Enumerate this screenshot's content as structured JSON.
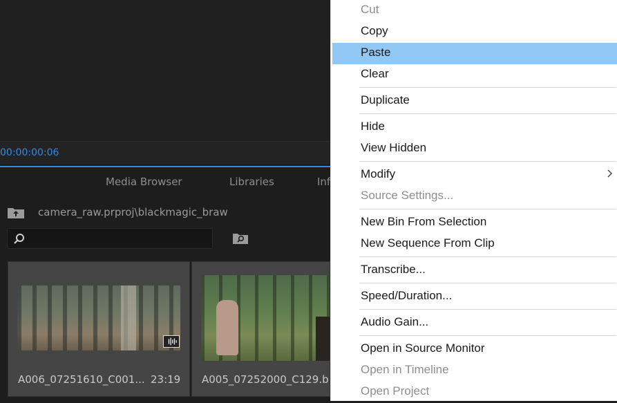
{
  "monitor": {
    "timecode": "00:00:00:06"
  },
  "panel": {
    "tabs": [
      "Media Browser",
      "Libraries",
      "Inf"
    ],
    "breadcrumb": "camera_raw.prproj\\blackmagic_braw",
    "search": {
      "value": "",
      "placeholder": ""
    }
  },
  "clips": [
    {
      "name": "A006_07251610_C001...",
      "duration": "23:19"
    },
    {
      "name": "A005_07252000_C129.b...",
      "duration": ""
    }
  ],
  "menu": {
    "items": [
      {
        "label": "Cut",
        "enabled": false
      },
      {
        "label": "Copy",
        "enabled": true
      },
      {
        "label": "Paste",
        "enabled": true,
        "highlighted": true
      },
      {
        "label": "Clear",
        "enabled": true
      },
      {
        "label": "Duplicate",
        "enabled": true
      },
      {
        "label": "Hide",
        "enabled": true
      },
      {
        "label": "View Hidden",
        "enabled": true
      },
      {
        "label": "Modify",
        "enabled": true,
        "submenu": true
      },
      {
        "label": "Source Settings...",
        "enabled": false
      },
      {
        "label": "New Bin From Selection",
        "enabled": true
      },
      {
        "label": "New Sequence From Clip",
        "enabled": true
      },
      {
        "label": "Transcribe...",
        "enabled": true
      },
      {
        "label": "Speed/Duration...",
        "enabled": true
      },
      {
        "label": "Audio Gain...",
        "enabled": true
      },
      {
        "label": "Open in Source Monitor",
        "enabled": true
      },
      {
        "label": "Open in Timeline",
        "enabled": false
      },
      {
        "label": "Open Project",
        "enabled": false
      }
    ]
  },
  "colors": {
    "accent": "#2d8ceb",
    "highlight": "#92c8f5",
    "disabled_text": "#8d8d8d"
  },
  "icons": {
    "breadcrumb": "folder-up-icon",
    "search": "search-icon",
    "find": "find-folder-icon",
    "submenu": "chevron-right-icon",
    "audio": "audio-waveform-icon"
  }
}
